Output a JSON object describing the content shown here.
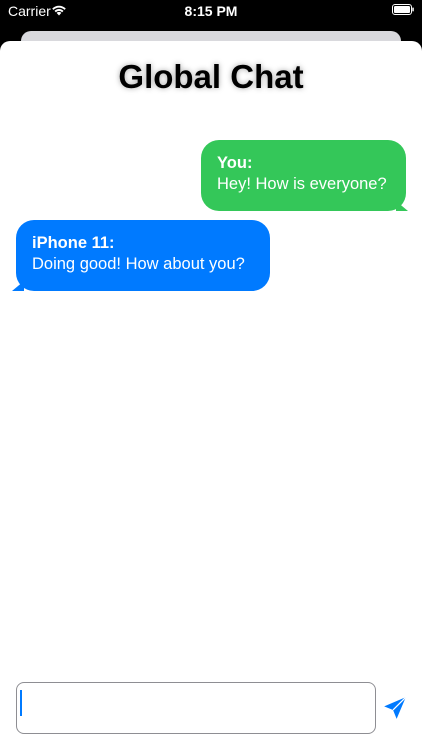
{
  "status_bar": {
    "carrier": "Carrier",
    "time": "8:15 PM"
  },
  "header": {
    "title": "Global Chat"
  },
  "messages": [
    {
      "sender": "You:",
      "text": "Hey! How is everyone?",
      "side": "right",
      "color": "#34c759"
    },
    {
      "sender": "iPhone 11:",
      "text": "Doing good! How about you?",
      "side": "left",
      "color": "#007aff"
    }
  ],
  "composer": {
    "value": "",
    "placeholder": "",
    "send_icon": "send-icon",
    "accent_color": "#007aff"
  }
}
